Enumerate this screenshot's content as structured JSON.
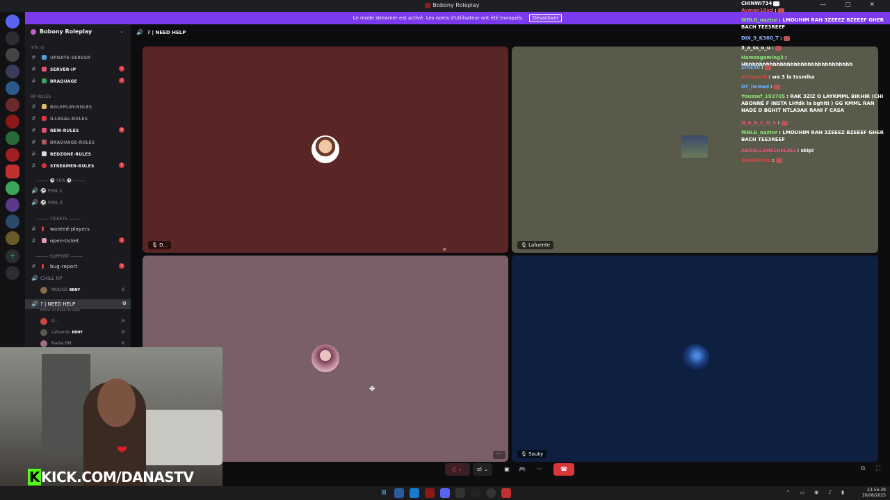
{
  "window": {
    "title": "Bobony Roleplay"
  },
  "banner": {
    "text": "Le mode streamer est activé. Les noms d'utilisateur ont été tronqués.",
    "button": "Désactiver"
  },
  "server": {
    "name": "Bobony Roleplay"
  },
  "categories": {
    "info": "info rp",
    "rules": "RP RULES",
    "fifa": "FIFA",
    "tickets": "TICKETS",
    "support": "SUPPORT"
  },
  "channels": [
    {
      "label": "UPDATE-SERVER",
      "color": "#4aa3df",
      "count": ""
    },
    {
      "label": "SERVER-IP",
      "color": "#e0557a",
      "count": "1"
    },
    {
      "label": "BRAQUAGE",
      "color": "#3ba55c",
      "count": "2"
    },
    {
      "label": "ROLEPLAY-RULES",
      "color": "#e5b96a",
      "count": ""
    },
    {
      "label": "ILLEGAL-RULES",
      "color": "#da373c",
      "count": ""
    },
    {
      "label": "NEW-RULES",
      "color": "#e0557a",
      "count": "8"
    },
    {
      "label": "BRAQUAGE-RULES",
      "color": "#b05a5a",
      "count": ""
    },
    {
      "label": "REDZONE-RULES",
      "color": "#ddd",
      "count": ""
    },
    {
      "label": "STREAMER-RULES",
      "color": "#da373c",
      "count": "1"
    }
  ],
  "fifa_channels": [
    "FIFA 1",
    "FIFA 2"
  ],
  "ticket_channels": [
    {
      "label": "wanted-players",
      "count": ""
    },
    {
      "label": "open-ticket",
      "count": "1"
    }
  ],
  "support_channels": [
    {
      "label": "bug-report",
      "count": "1"
    }
  ],
  "voice": {
    "chill": "CHILL RP",
    "chill_user": "MOU4D",
    "chill_tag": "BBNY",
    "active": "NEED HELP",
    "hint": "Définir un statut de salon",
    "users": [
      {
        "name": "D...",
        "tag": ""
      },
      {
        "name": "Lafuente",
        "tag": "BBNY"
      },
      {
        "name": "Nadia BM",
        "tag": ""
      }
    ]
  },
  "header": {
    "channel": "NEED HELP"
  },
  "tiles": [
    {
      "label": "D..."
    },
    {
      "label": "Lafuente"
    },
    {
      "label": ""
    },
    {
      "label": "Souky"
    }
  ],
  "chat": [
    {
      "user": "CHINWI734",
      "color": "#fff",
      "text": ""
    },
    {
      "user": "Ayman10xd",
      "color": "#e0557a",
      "text": ""
    },
    {
      "user": "WBLG_naztor",
      "color": "#8be37a",
      "text": "LMOUHIM RAH 3ZEEEZ BZEEEF GHER BACH TEE3REEF"
    },
    {
      "user": "DIX_9_K360_T",
      "color": "#8ab4ff",
      "text": ""
    },
    {
      "user": "3_a_ss_o_u",
      "color": "#fff",
      "text": ""
    },
    {
      "user": "Hamzagaming3",
      "color": "#8be37a",
      "text": "Hhhhhhhhhhhhhhhhhhhhhhhhhhhhhhhh"
    },
    {
      "user": "ZiREx0",
      "color": "#6ab0ff",
      "text": ""
    },
    {
      "user": "Kittyren0",
      "color": "#d9443f",
      "text": "wa 3 la tssmlka"
    },
    {
      "user": "DT_lm9wd",
      "color": "#6ab0ff",
      "text": ""
    },
    {
      "user": "Youssef_193705",
      "color": "#8be37a",
      "text": "RAK 3ZIZ O LAYKMML BIKHIR (CHI ABONNÉ F INSTA LHfdk la bghiti ) GG KMML RAN NADE O BGHIT NTLA9AK RANI F CASA"
    },
    {
      "user": "N_A_R_C_O_S",
      "color": "#e0557a",
      "text": ""
    },
    {
      "user": "WBLG_naztor",
      "color": "#8be37a",
      "text": "LMOUHIM RAH 3ZEEEZ BZEEEF GHER BACH TEE3REEF"
    },
    {
      "user": "ABDELLAHELHELALI",
      "color": "#e0557a",
      "text": "skipi"
    },
    {
      "user": "dark5ifane",
      "color": "#d9443f",
      "text": ""
    }
  ],
  "overlay": {
    "kick_k": "K",
    "kick_rest": "KICK.COM/DANASTV"
  },
  "taskbar": {
    "time": "23:56:39",
    "date": "19/08/2025"
  }
}
